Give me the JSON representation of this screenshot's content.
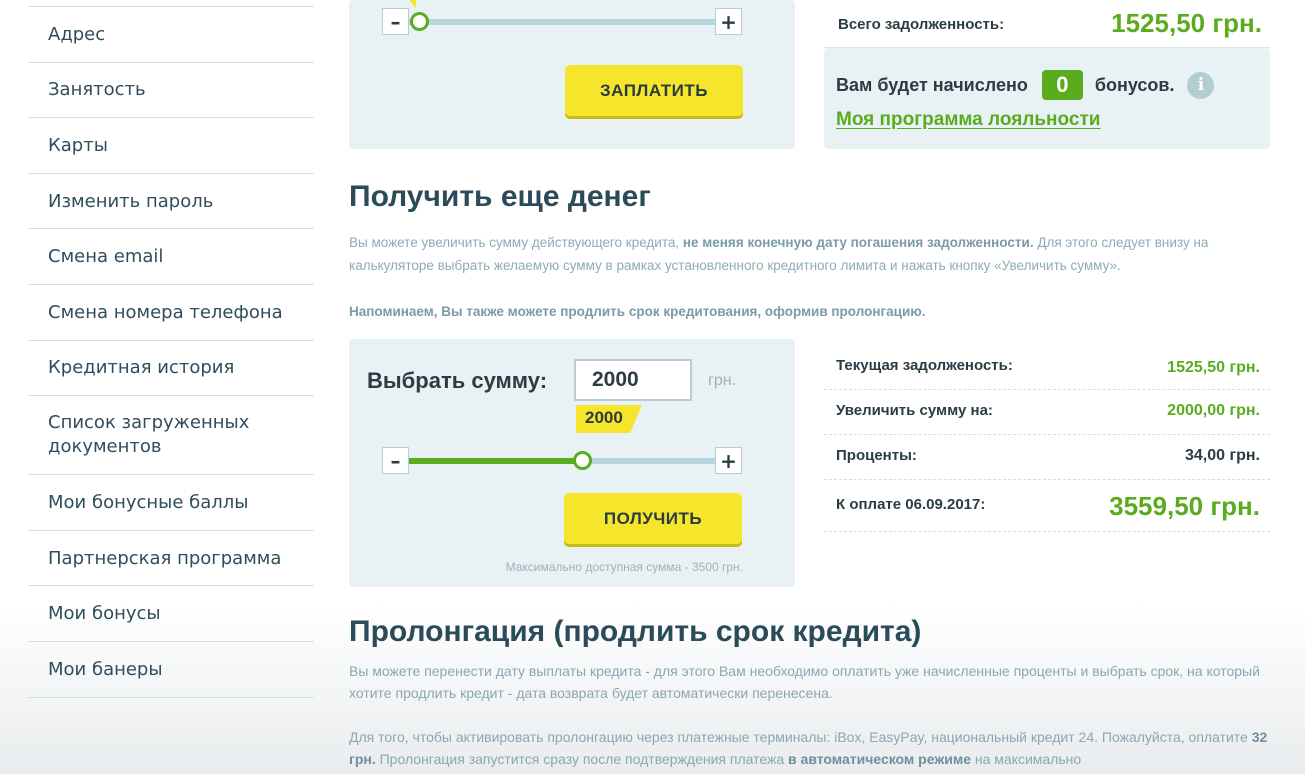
{
  "sidebar": {
    "items": [
      "Адрес",
      "Занятость",
      "Карты",
      "Изменить пароль",
      "Смена email",
      "Смена номера телефона",
      "Кредитная история",
      "Список загруженных документов",
      "Мои бонусные баллы",
      "Партнерская программа",
      "Мои бонусы",
      "Мои банеры"
    ]
  },
  "top_panel": {
    "minus": "–",
    "plus": "+",
    "slider_level_percent": 0,
    "pay_button": "ЗАПЛАТИТЬ"
  },
  "debt": {
    "label": "Всего задолженность:",
    "value": "1525,50 грн."
  },
  "bonus": {
    "prefix": "Вам будет начислено",
    "count": "0",
    "suffix": "бонусов.",
    "info_glyph": "i",
    "loyalty_link": "Моя программа лояльности"
  },
  "get_more": {
    "title": "Получить еще денег",
    "para1_a": "Вы можете увеличить сумму действующего кредита, ",
    "para1_bold": "не меняя конечную дату погашения задолженности.",
    "para1_b": " Для этого следует внизу на калькуляторе выбрать желаемую сумму в рамках установленного кредитного лимита и нажать кнопку «Увеличить сумму».",
    "para2_bold": "Напоминаем, Вы также можете продлить срок кредитования, оформив пролонгацию."
  },
  "calculator": {
    "label": "Выбрать сумму:",
    "input_value": "2000",
    "unit": "грн.",
    "flag_value": "2000",
    "minus": "–",
    "plus": "+",
    "slider_level_percent": 57,
    "get_button": "ПОЛУЧИТЬ",
    "max_note": "Максимально доступная сумма - 3500 грн."
  },
  "summary": {
    "rows": [
      {
        "label": "Текущая задолженость:",
        "value": "1525,50 грн."
      },
      {
        "label": "Увеличить сумму на:",
        "value": "2000,00 грн."
      },
      {
        "label": "Проценты:",
        "value": "34,00 грн."
      },
      {
        "label": "К оплате 06.09.2017:",
        "value": "3559,50 грн."
      }
    ]
  },
  "prolong": {
    "title": "Пролонгация (продлить срок кредита)",
    "para1": "Вы можете перенести дату выплаты кредита - для этого Вам необходимо оплатить уже начисленные проценты и выбрать срок, на который хотите продлить кредит - дата возврата будет автоматически перенесена.",
    "para2_a": "Для того, чтобы активировать пролонгацию через платежные терминалы: iBox, EasyPay, национальный кредит 24. Пожалуйста, оплатите ",
    "para2_bold1": "32 грн.",
    "para2_b": " Пролонгация запустится сразу после подтверждения платежа ",
    "para2_bold2": "в автоматическом режиме",
    "para2_c": " на максимально"
  }
}
